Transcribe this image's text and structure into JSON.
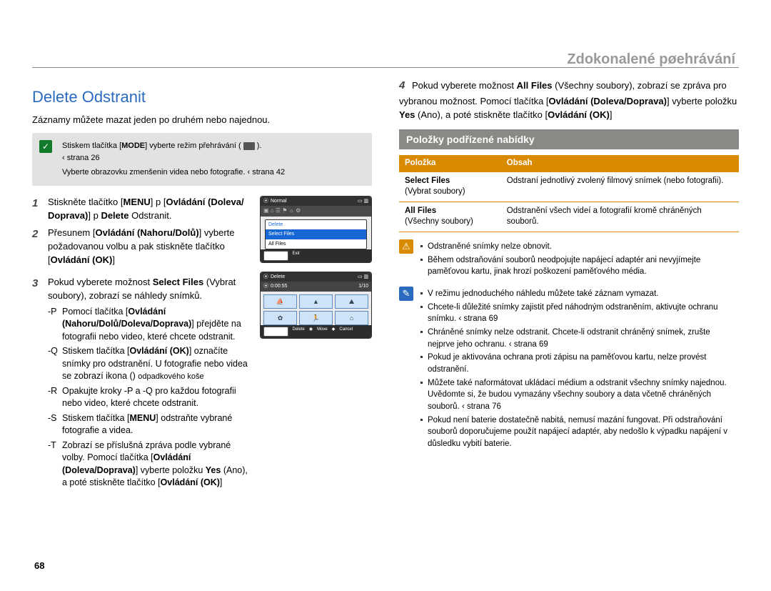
{
  "breadcrumb": "Zdokonalené pøehrávání",
  "title": "Delete Odstranit",
  "lead": "Záznamy můžete mazat jeden po druhém nebo najednou.",
  "precheck": {
    "line1_pre": "Stiskem tlačítka [",
    "line1_bold": "MODE",
    "line1_post": "] vyberte režim přehrávání (",
    "line1_end": ").",
    "line1_ref": "‹ strana 26",
    "line2": "Vyberte obrazovku zmenšenin videa nebo fotografie.  ‹ strana 42"
  },
  "steps": {
    "s1": {
      "n": "1",
      "t_pre": "Stiskněte tlačítko [",
      "t_b1": "MENU",
      "t_mid1": "]  p [",
      "t_b2": "Ovládání (Doleva/ Doprava)",
      "t_mid2": "]  p ",
      "t_b3": "Delete",
      "t_end": " Odstranit."
    },
    "s2": {
      "n": "2",
      "pre": "Přesunem [",
      "b1": "Ovládání (Nahoru/Dolů)",
      "mid1": "] vyberte požadovanou volbu a pak stiskněte tlačítko [",
      "b2": "Ovládání (OK)",
      "end": "]"
    },
    "s3": {
      "n": "3",
      "pre": "Pokud vyberete možnost ",
      "b1": "Select Files",
      "post": " (Vybrat soubory), zobrazí se náhledy snímků."
    },
    "sub": {
      "a": {
        "dash": "-P",
        "pre": "Pomocí tlačítka [",
        "b": "Ovládání (Nahoru/Dolů/Doleva/Doprava)",
        "post": "] přejděte na fotografii nebo video, které chcete odstranit."
      },
      "b": {
        "dash": "-Q",
        "pre": "Stiskem tlačítka [",
        "b": "Ovládání (OK)",
        "post": "] označíte snímky pro odstranění. U fotografie nebo videa se zobrazí ikona () ",
        "tiny": "odpadkového koše"
      },
      "c": {
        "dash": "-R",
        "text": "Opakujte kroky  -P a  -Q pro každou fotografii nebo video, které chcete odstranit."
      },
      "d": {
        "dash": "-S",
        "pre": "Stiskem tlačítka [",
        "b": "MENU",
        "post": "] odstraňte vybrané fotografie a videa."
      },
      "e": {
        "dash": "-T",
        "pre": "Zobrazí se příslušná zpráva podle vybrané volby. Pomocí tlačítka [",
        "b": "Ovládání (Doleva/Doprava)",
        "mid": "] vyberte položku ",
        "b2": "Yes",
        "post": " (Ano), a poté stiskněte tlačítko [",
        "b3": "Ovládání (OK)",
        "end": "]"
      }
    },
    "s4": {
      "n": "4",
      "pre": "Pokud vyberete možnost ",
      "b1": "All Files",
      "mid1": " (Všechny soubory), zobrazí se zpráva pro vybranou možnost. Pomocí tlačítka [",
      "b2": "Ovládání (Doleva/Doprava)",
      "mid2": "] vyberte položku ",
      "b3": "Yes",
      "mid3": " (Ano), a poté stiskněte tlačítko [",
      "b4": "Ovládání (OK)",
      "end": "]"
    }
  },
  "screen1": {
    "normal": "Normal",
    "m_delete": "Delete",
    "m_select": "Select Files",
    "m_all": "All Files",
    "foot_exit": "Exit",
    "foot_menu": "MENU"
  },
  "screen2": {
    "title": "Delete",
    "time": "0:00:55",
    "count": "1/10",
    "foot_menu": "MENU",
    "foot_delete": "Delete",
    "foot_move": "Move",
    "foot_cancel": "Cancel"
  },
  "subhead": "Položky podřízené nabídky",
  "table": {
    "h1": "Položka",
    "h2": "Obsah",
    "r1c1a": "Select Files",
    "r1c1b": "(Vybrat soubory)",
    "r1c2": "Odstraní jednotlivý zvolený filmový snímek (nebo fotografii).",
    "r2c1a": "All Files",
    "r2c1b": "(Všechny soubory)",
    "r2c2": "Odstranění všech videí a fotografií kromě chráněných souborů."
  },
  "warn": {
    "l1": "Odstraněné snímky nelze obnovit.",
    "l2": "Během odstraňování souborů neodpojujte napájecí adaptér ani nevyjímejte paměťovou kartu, jinak hrozí poškození paměťového média."
  },
  "info": {
    "l1": "V režimu jednoduchého náhledu můžete také záznam vymazat.",
    "l2": "Chcete-li důležité snímky zajistit před náhodným odstraněním, aktivujte ochranu snímku.  ‹ strana 69",
    "l3": "Chráněné snímky nelze odstranit. Chcete-li odstranit chráněný snímek, zrušte nejprve jeho ochranu.  ‹ strana 69",
    "l4": "Pokud je aktivována ochrana proti zápisu na paměťovou kartu, nelze provést odstranění.",
    "l5": "Můžete také naformátovat ukládací médium a odstranit všechny snímky najednou. Uvědomte si, že budou vymazány všechny soubory a data včetně chráněných souborů.  ‹ strana 76",
    "l6": "Pokud není baterie dostatečně nabitá, nemusí mazání fungovat. Při odstraňování souborů doporučujeme použít napájecí adaptér, aby nedošlo k výpadku napájení v důsledku vybití baterie."
  },
  "pagenum": "68"
}
